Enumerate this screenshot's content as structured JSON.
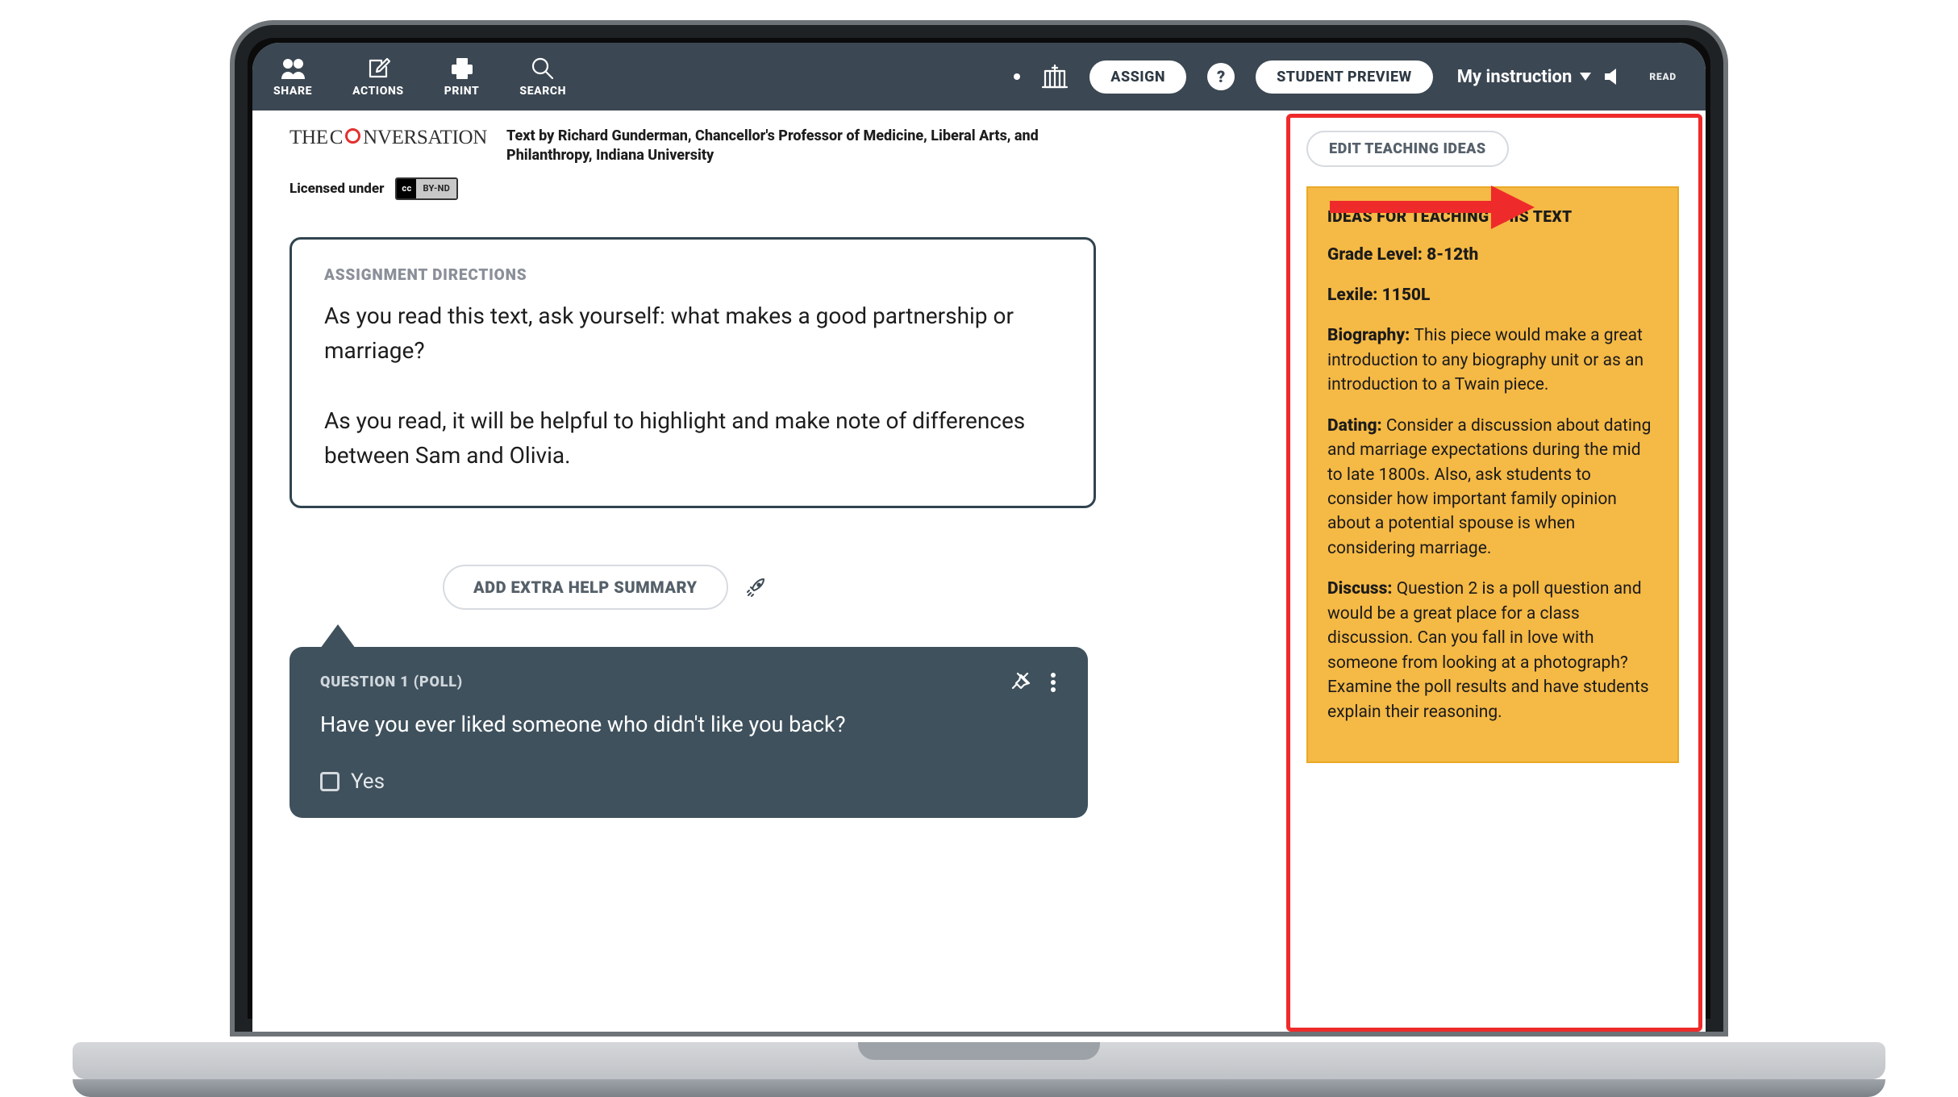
{
  "toolbar": {
    "share": "SHARE",
    "actions": "ACTIONS",
    "print": "PRINT",
    "search": "SEARCH",
    "assign": "ASSIGN",
    "preview": "STUDENT PREVIEW",
    "my_instruction": "My instruction",
    "read": "READ"
  },
  "attribution": {
    "logo_the": "THE ",
    "logo_c": "C",
    "logo_rest": "NVERSATION",
    "byline": "Text by Richard Gunderman, Chancellor's Professor of Medicine, Liberal Arts, and Philanthropy, Indiana University",
    "license_label": "Licensed under",
    "cc_text": "BY-ND"
  },
  "directions": {
    "label": "ASSIGNMENT DIRECTIONS",
    "p1": "As you read this text, ask yourself: what makes a good partnership or marriage?",
    "p2": "As you read, it will be helpful to highlight and make note of differences between Sam and Olivia."
  },
  "extra_help": "ADD EXTRA HELP SUMMARY",
  "question": {
    "header": "QUESTION 1 (POLL)",
    "text": "Have you ever liked someone who didn't like you back?",
    "opt1": "Yes"
  },
  "sidebar": {
    "edit": "EDIT TEACHING IDEAS",
    "title": "IDEAS FOR TEACHING THIS TEXT",
    "grade_label": "Grade Level: ",
    "grade_value": "8-12th",
    "lexile_label": "Lexile: ",
    "lexile_value": "1150L",
    "bio_label": "Biography: ",
    "bio_text": "This piece would make a great introduction to any biography unit or as an introduction to a Twain piece.",
    "dating_label": "Dating: ",
    "dating_text": "Consider a discussion about dating and marriage expectations during the mid to late 1800s. Also, ask students to consider how important family opinion about a potential spouse is when considering marriage.",
    "discuss_label": "Discuss: ",
    "discuss_text": "Question 2 is a poll question and would be a great place for a class discussion. Can you fall in love with someone from looking at a photograph? Examine the poll results and have students explain their reasoning."
  }
}
